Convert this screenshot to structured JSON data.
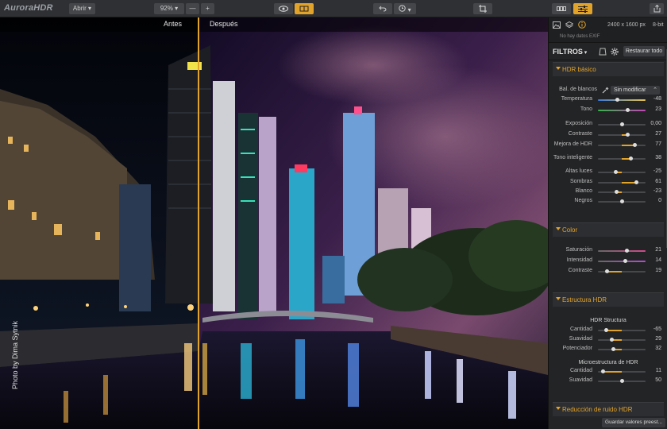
{
  "app": {
    "logo": "AuroraHDR"
  },
  "toolbar": {
    "open": "Abrir",
    "zoom": "92%",
    "zoom_out": "—",
    "zoom_in": "+"
  },
  "compare": {
    "before": "Antes",
    "after": "Después"
  },
  "photo_credit": "Photo by Dima Sytnik",
  "image_info": {
    "size": "2400 x 1600 px",
    "bits": "8-bit",
    "exif": "No hay datos EXIF"
  },
  "filters": {
    "title": "FILTROS",
    "reset": "Restaurar todo",
    "save_preset": "Guardar valores preest..."
  },
  "sections": [
    {
      "name": "HDR básico"
    },
    {
      "name": "Color"
    },
    {
      "name": "Estructura HDR"
    },
    {
      "name": "Reducción de ruido HDR"
    }
  ],
  "wb": {
    "label": "Bal. de blancos",
    "value": "Sin modificar"
  },
  "hdr_basic": [
    {
      "label": "Temperatura",
      "value": "-48",
      "pos": 0.4,
      "track": "temp"
    },
    {
      "label": "Tono",
      "value": "23",
      "pos": 0.62,
      "track": "tint"
    },
    {
      "label": "Exposición",
      "value": "0,00",
      "pos": 0.5
    },
    {
      "label": "Contraste",
      "value": "27",
      "pos": 0.63
    },
    {
      "label": "Mejora de HDR",
      "value": "77",
      "pos": 0.77
    },
    {
      "label": "Tono inteligente",
      "value": "38",
      "pos": 0.69
    },
    {
      "label": "Altas luces",
      "value": "-25",
      "pos": 0.38
    },
    {
      "label": "Sombras",
      "value": "61",
      "pos": 0.8
    },
    {
      "label": "Blanco",
      "value": "-23",
      "pos": 0.39
    },
    {
      "label": "Negros",
      "value": "0",
      "pos": 0.5
    }
  ],
  "color": [
    {
      "label": "Saturación",
      "value": "21",
      "pos": 0.6,
      "track": "sat"
    },
    {
      "label": "Intensidad",
      "value": "14",
      "pos": 0.57,
      "track": "int"
    },
    {
      "label": "Contraste",
      "value": "19",
      "pos": 0.19
    }
  ],
  "structure": {
    "sub1": "HDR Structura",
    "rows1": [
      {
        "label": "Cantidad",
        "value": "-65",
        "pos": 0.18
      },
      {
        "label": "Suavidad",
        "value": "29",
        "pos": 0.29
      },
      {
        "label": "Potenciador",
        "value": "32",
        "pos": 0.32
      }
    ],
    "sub2": "Microestructura de HDR",
    "rows2": [
      {
        "label": "Cantidad",
        "value": "11",
        "pos": 0.11
      },
      {
        "label": "Suavidad",
        "value": "50",
        "pos": 0.5
      }
    ]
  },
  "colors": {
    "accent": "#e2a32a",
    "panel": "#232426",
    "toolbar": "#2f3033"
  }
}
